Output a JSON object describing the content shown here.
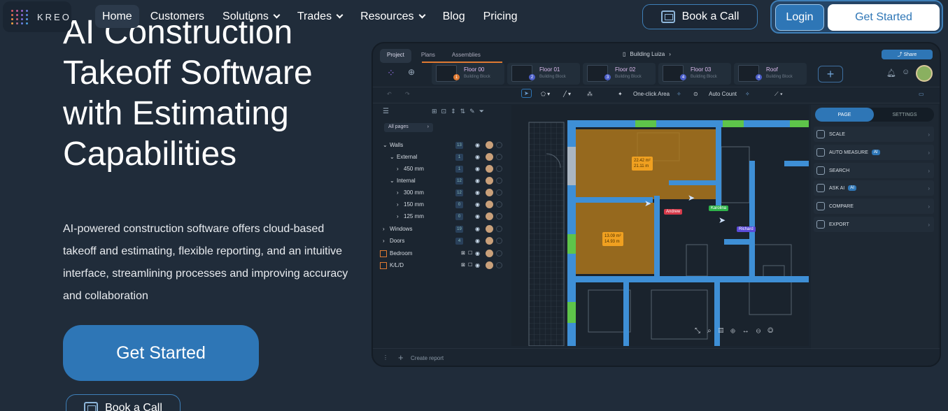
{
  "nav": {
    "logo_text": "KREO",
    "items": [
      {
        "label": "Home",
        "active": true,
        "dropdown": false
      },
      {
        "label": "Customers",
        "active": false,
        "dropdown": false
      },
      {
        "label": "Solutions",
        "active": false,
        "dropdown": true
      },
      {
        "label": "Trades",
        "active": false,
        "dropdown": true
      },
      {
        "label": "Resources",
        "active": false,
        "dropdown": true
      },
      {
        "label": "Blog",
        "active": false,
        "dropdown": false
      },
      {
        "label": "Pricing",
        "active": false,
        "dropdown": false
      }
    ],
    "book_call": "Book a Call",
    "login": "Login",
    "get_started": "Get Started"
  },
  "hero": {
    "headline": "AI Construction Takeoff Software with Estimating Capabilities",
    "subtitle": "AI-powered construction software offers cloud-based takeoff and estimating, flexible reporting, and an intuitive interface, streamlining processes and improving accuracy and collaboration",
    "cta_primary": "Get Started",
    "cta_secondary": "Book a Call"
  },
  "app": {
    "tabs": [
      "Project",
      "Plans",
      "Assemblies"
    ],
    "document": "Building Luiza",
    "share": "Share",
    "floors": [
      {
        "name": "Floor 00",
        "sub": "Building Block",
        "badge": "1"
      },
      {
        "name": "Floor 01",
        "sub": "Building Block",
        "badge": "2"
      },
      {
        "name": "Floor 02",
        "sub": "Building Block",
        "badge": "3"
      },
      {
        "name": "Floor 03",
        "sub": "Building Block",
        "badge": "4"
      },
      {
        "name": "Roof",
        "sub": "Building Block",
        "badge": "4"
      }
    ],
    "toolbar": {
      "one_click": "One-click Area",
      "auto_count": "Auto Count"
    },
    "all_pages": "All pages",
    "tree": [
      {
        "label": "Walls",
        "count": "13",
        "indent": 0
      },
      {
        "label": "External",
        "count": "1",
        "indent": 1
      },
      {
        "label": "450 mm",
        "count": "1",
        "indent": 2
      },
      {
        "label": "Internal",
        "count": "12",
        "indent": 1
      },
      {
        "label": "300 mm",
        "count": "12",
        "indent": 2
      },
      {
        "label": "150 mm",
        "count": "0",
        "indent": 2
      },
      {
        "label": "125 mm",
        "count": "0",
        "indent": 2
      },
      {
        "label": "Windows",
        "count": "19",
        "indent": 0
      },
      {
        "label": "Doors",
        "count": "4",
        "indent": 0
      },
      {
        "label": "Bedroom",
        "count": "",
        "indent": 0
      },
      {
        "label": "K/L/D",
        "count": "",
        "indent": 0
      }
    ],
    "right_tabs": [
      "PAGE",
      "SETTINGS"
    ],
    "right_items": [
      {
        "label": "SCALE",
        "ai": ""
      },
      {
        "label": "AUTO MEASURE",
        "ai": "AI"
      },
      {
        "label": "SEARCH",
        "ai": ""
      },
      {
        "label": "ASK AI",
        "ai": "AI"
      },
      {
        "label": "COMPARE",
        "ai": ""
      },
      {
        "label": "EXPORT",
        "ai": ""
      }
    ],
    "areas": [
      {
        "a": "22.42 m²",
        "p": "21.11 m"
      },
      {
        "a": "13.09 m²",
        "p": "14.93 m"
      }
    ],
    "users": [
      "Andrew",
      "Karolina",
      "Richard"
    ],
    "create_report": "Create report"
  }
}
